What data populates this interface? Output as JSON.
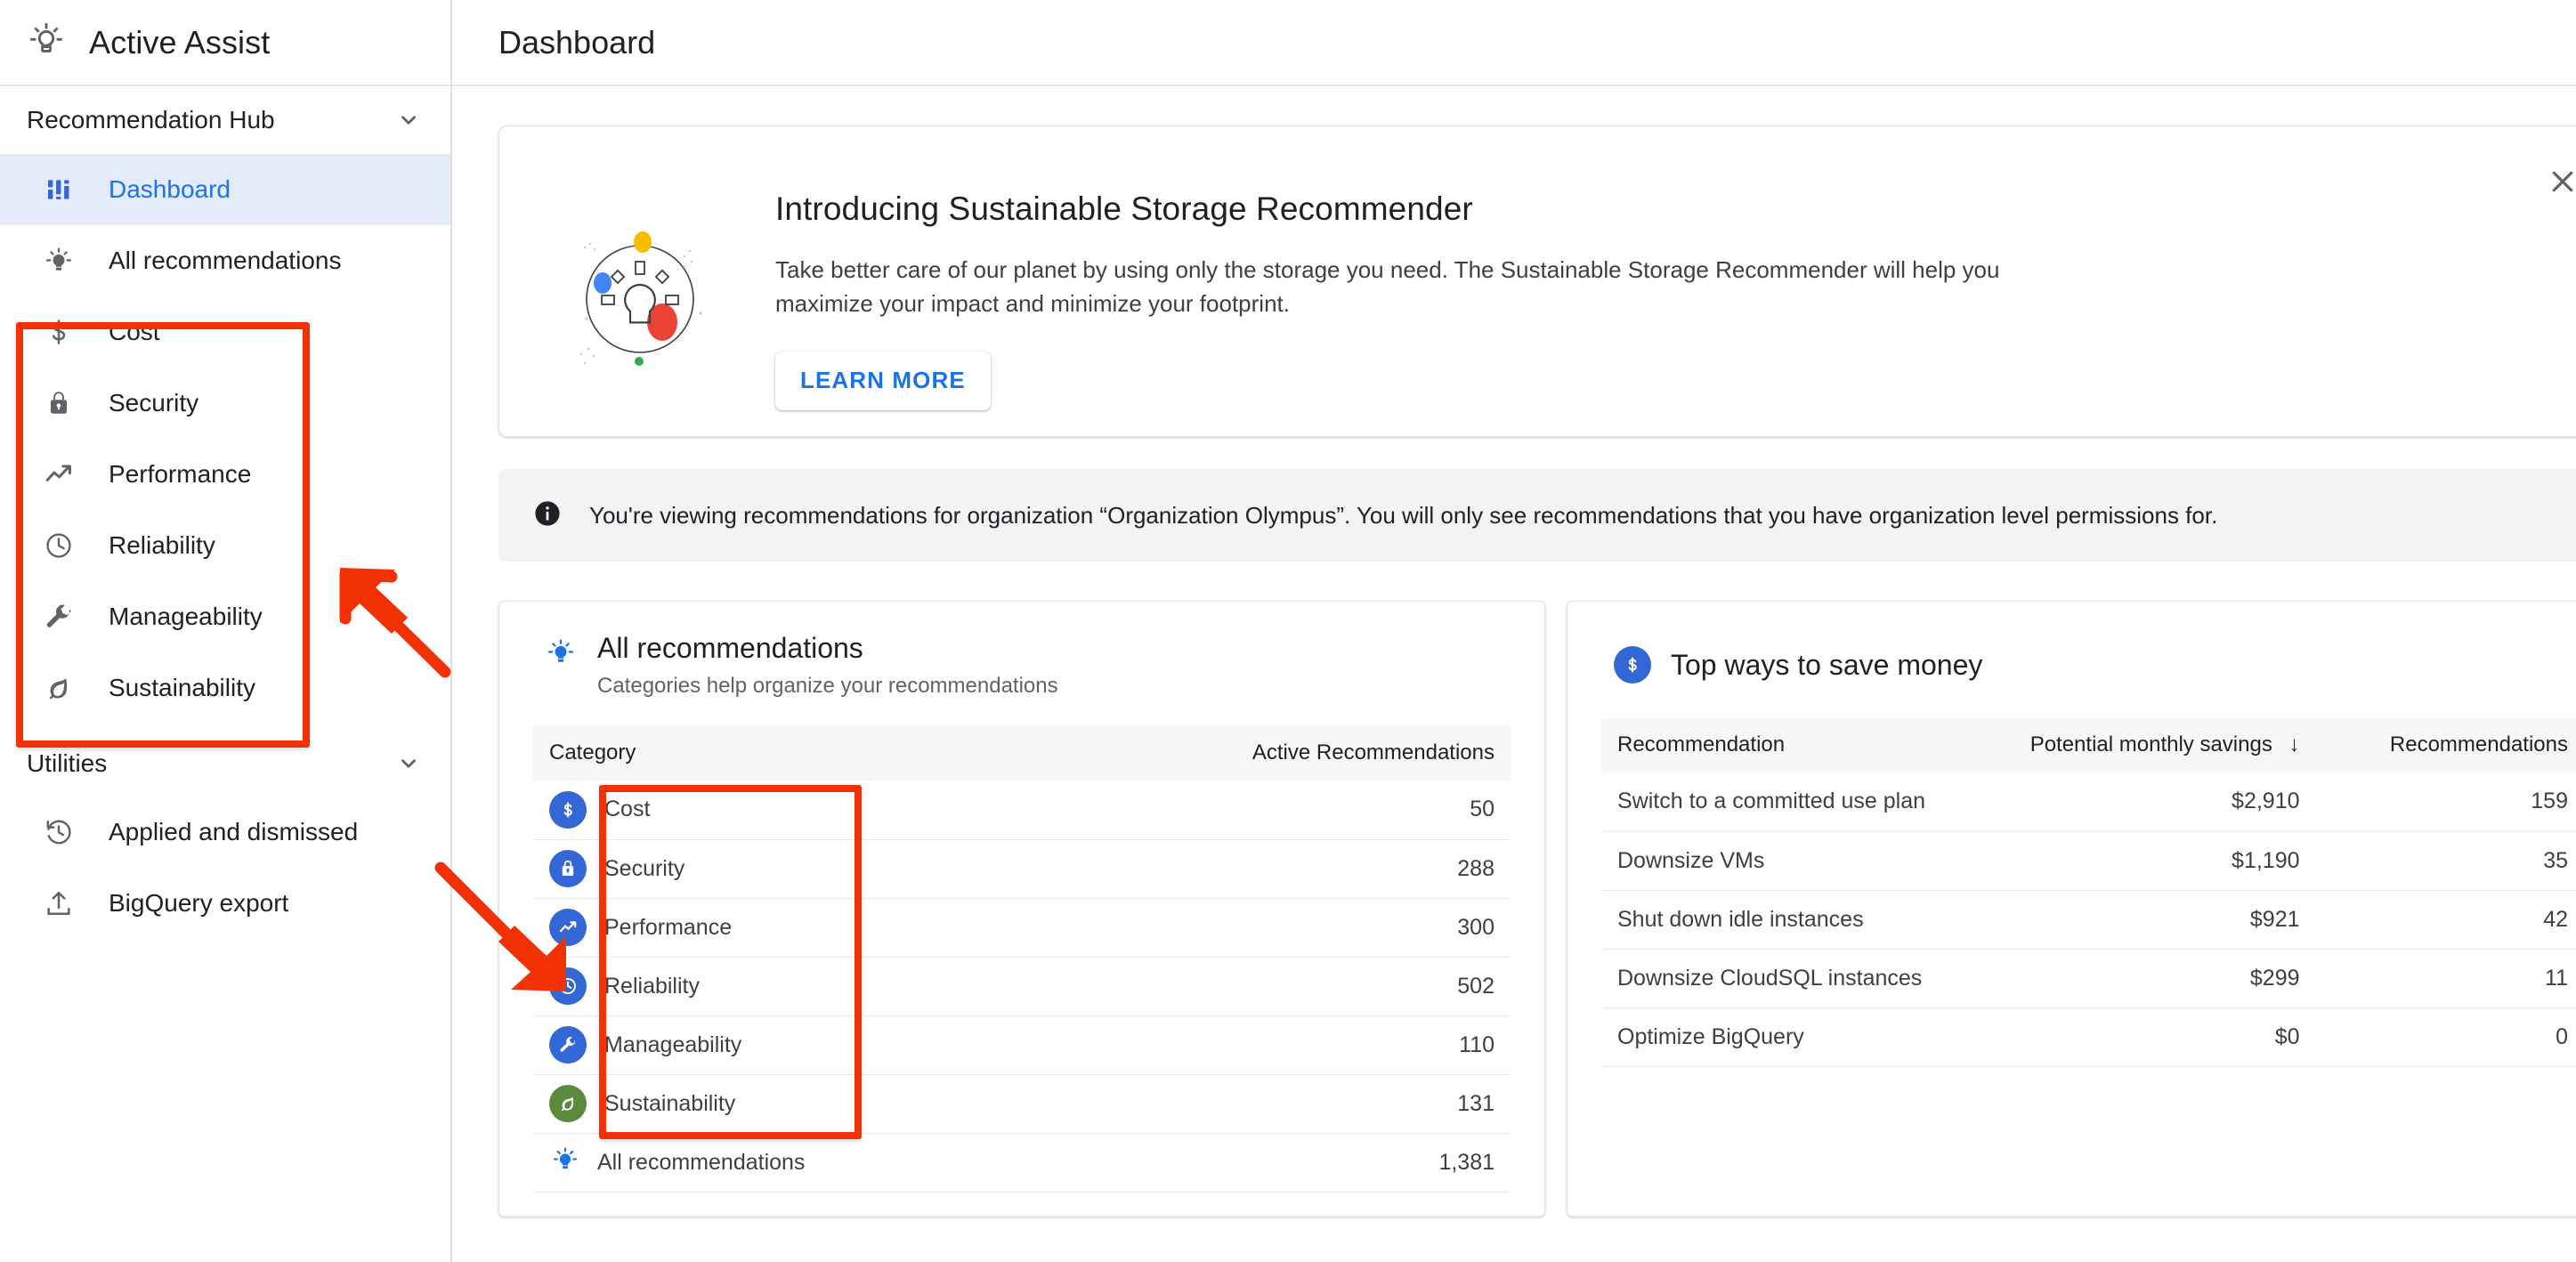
{
  "sidebar": {
    "brand": "Active Assist",
    "groups": [
      {
        "label": "Recommendation Hub",
        "expanded_icon": "chevron-down-icon"
      },
      {
        "label": "Utilities",
        "expanded_icon": "chevron-down-icon"
      }
    ],
    "hub_items": [
      {
        "label": "Dashboard",
        "icon": "dashboard-icon",
        "active": true
      },
      {
        "label": "All recommendations",
        "icon": "lightbulb-icon",
        "active": false
      },
      {
        "label": "Cost",
        "icon": "dollar-icon",
        "active": false
      },
      {
        "label": "Security",
        "icon": "lock-icon",
        "active": false
      },
      {
        "label": "Performance",
        "icon": "trending-up-icon",
        "active": false
      },
      {
        "label": "Reliability",
        "icon": "clock-icon",
        "active": false
      },
      {
        "label": "Manageability",
        "icon": "wrench-icon",
        "active": false
      },
      {
        "label": "Sustainability",
        "icon": "leaf-icon",
        "active": false
      }
    ],
    "utility_items": [
      {
        "label": "Applied and dismissed",
        "icon": "history-icon"
      },
      {
        "label": "BigQuery export",
        "icon": "upload-icon"
      }
    ]
  },
  "header": {
    "title": "Dashboard"
  },
  "promo": {
    "title": "Introducing Sustainable Storage Recommender",
    "body": "Take better care of our planet by using only the storage you need. The Sustainable Storage Recommender will help you maximize your impact and minimize your footprint.",
    "cta": "LEARN MORE",
    "close_icon": "close-icon",
    "art_icon": "lightbulb-circle-illustration"
  },
  "info_banner": {
    "icon": "info-icon",
    "text": "You're viewing recommendations for organization “Organization Olympus”. You will only see recommendations that you have organization level permissions for."
  },
  "all_recommendations_card": {
    "icon": "lightbulb-icon",
    "title": "All recommendations",
    "subtitle": "Categories help organize your recommendations",
    "columns": [
      "Category",
      "Active Recommendations"
    ],
    "rows": [
      {
        "category": "Cost",
        "icon": "dollar-badge-icon",
        "color": "blue",
        "count": "50"
      },
      {
        "category": "Security",
        "icon": "lock-badge-icon",
        "color": "blue",
        "count": "288"
      },
      {
        "category": "Performance",
        "icon": "trending-up-badge-icon",
        "color": "blue",
        "count": "300"
      },
      {
        "category": "Reliability",
        "icon": "clock-badge-icon",
        "color": "blue",
        "count": "502"
      },
      {
        "category": "Manageability",
        "icon": "wrench-badge-icon",
        "color": "blue",
        "count": "110"
      },
      {
        "category": "Sustainability",
        "icon": "leaf-badge-icon",
        "color": "green",
        "count": "131"
      }
    ],
    "total_row": {
      "label": "All recommendations",
      "icon": "lightbulb-icon",
      "count": "1,381"
    }
  },
  "savings_card": {
    "icon": "dollar-badge-icon",
    "title": "Top ways to save money",
    "columns": [
      "Recommendation",
      "Potential monthly savings",
      "Recommendations"
    ],
    "sort_indicator": "↓",
    "rows": [
      {
        "name": "Switch to a committed use plan",
        "savings": "$2,910",
        "count": "159"
      },
      {
        "name": "Downsize VMs",
        "savings": "$1,190",
        "count": "35"
      },
      {
        "name": "Shut down idle instances",
        "savings": "$921",
        "count": "42"
      },
      {
        "name": "Downsize CloudSQL instances",
        "savings": "$299",
        "count": "11"
      },
      {
        "name": "Optimize BigQuery",
        "savings": "$0",
        "count": "0"
      }
    ]
  },
  "colors": {
    "accent_blue": "#1a73e8",
    "badge_blue": "#3367d6",
    "badge_green": "#5c8a3c",
    "annotation_red": "#f43104",
    "active_nav_bg": "#e4eaf8",
    "info_bg": "#f1f3f4"
  },
  "annotations": {
    "highlight_rects": 2,
    "arrows": 2
  }
}
